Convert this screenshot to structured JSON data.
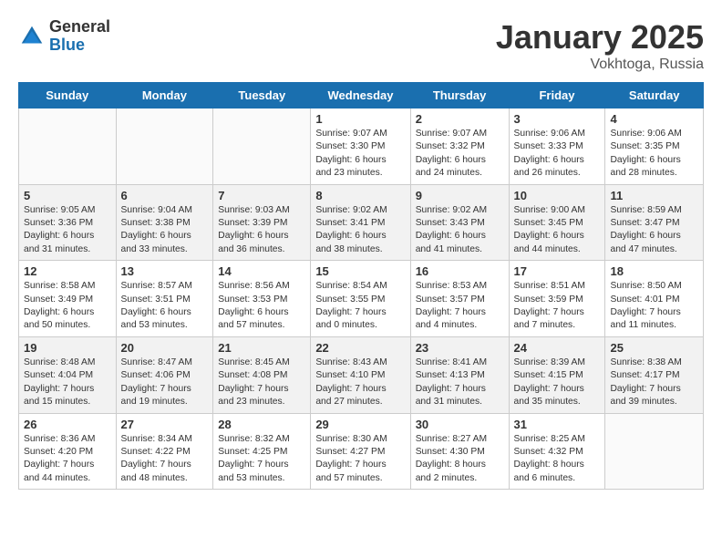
{
  "logo": {
    "general": "General",
    "blue": "Blue"
  },
  "title": "January 2025",
  "location": "Vokhtoga, Russia",
  "days_of_week": [
    "Sunday",
    "Monday",
    "Tuesday",
    "Wednesday",
    "Thursday",
    "Friday",
    "Saturday"
  ],
  "weeks": [
    [
      {
        "day": "",
        "info": ""
      },
      {
        "day": "",
        "info": ""
      },
      {
        "day": "",
        "info": ""
      },
      {
        "day": "1",
        "info": "Sunrise: 9:07 AM\nSunset: 3:30 PM\nDaylight: 6 hours\nand 23 minutes."
      },
      {
        "day": "2",
        "info": "Sunrise: 9:07 AM\nSunset: 3:32 PM\nDaylight: 6 hours\nand 24 minutes."
      },
      {
        "day": "3",
        "info": "Sunrise: 9:06 AM\nSunset: 3:33 PM\nDaylight: 6 hours\nand 26 minutes."
      },
      {
        "day": "4",
        "info": "Sunrise: 9:06 AM\nSunset: 3:35 PM\nDaylight: 6 hours\nand 28 minutes."
      }
    ],
    [
      {
        "day": "5",
        "info": "Sunrise: 9:05 AM\nSunset: 3:36 PM\nDaylight: 6 hours\nand 31 minutes."
      },
      {
        "day": "6",
        "info": "Sunrise: 9:04 AM\nSunset: 3:38 PM\nDaylight: 6 hours\nand 33 minutes."
      },
      {
        "day": "7",
        "info": "Sunrise: 9:03 AM\nSunset: 3:39 PM\nDaylight: 6 hours\nand 36 minutes."
      },
      {
        "day": "8",
        "info": "Sunrise: 9:02 AM\nSunset: 3:41 PM\nDaylight: 6 hours\nand 38 minutes."
      },
      {
        "day": "9",
        "info": "Sunrise: 9:02 AM\nSunset: 3:43 PM\nDaylight: 6 hours\nand 41 minutes."
      },
      {
        "day": "10",
        "info": "Sunrise: 9:00 AM\nSunset: 3:45 PM\nDaylight: 6 hours\nand 44 minutes."
      },
      {
        "day": "11",
        "info": "Sunrise: 8:59 AM\nSunset: 3:47 PM\nDaylight: 6 hours\nand 47 minutes."
      }
    ],
    [
      {
        "day": "12",
        "info": "Sunrise: 8:58 AM\nSunset: 3:49 PM\nDaylight: 6 hours\nand 50 minutes."
      },
      {
        "day": "13",
        "info": "Sunrise: 8:57 AM\nSunset: 3:51 PM\nDaylight: 6 hours\nand 53 minutes."
      },
      {
        "day": "14",
        "info": "Sunrise: 8:56 AM\nSunset: 3:53 PM\nDaylight: 6 hours\nand 57 minutes."
      },
      {
        "day": "15",
        "info": "Sunrise: 8:54 AM\nSunset: 3:55 PM\nDaylight: 7 hours\nand 0 minutes."
      },
      {
        "day": "16",
        "info": "Sunrise: 8:53 AM\nSunset: 3:57 PM\nDaylight: 7 hours\nand 4 minutes."
      },
      {
        "day": "17",
        "info": "Sunrise: 8:51 AM\nSunset: 3:59 PM\nDaylight: 7 hours\nand 7 minutes."
      },
      {
        "day": "18",
        "info": "Sunrise: 8:50 AM\nSunset: 4:01 PM\nDaylight: 7 hours\nand 11 minutes."
      }
    ],
    [
      {
        "day": "19",
        "info": "Sunrise: 8:48 AM\nSunset: 4:04 PM\nDaylight: 7 hours\nand 15 minutes."
      },
      {
        "day": "20",
        "info": "Sunrise: 8:47 AM\nSunset: 4:06 PM\nDaylight: 7 hours\nand 19 minutes."
      },
      {
        "day": "21",
        "info": "Sunrise: 8:45 AM\nSunset: 4:08 PM\nDaylight: 7 hours\nand 23 minutes."
      },
      {
        "day": "22",
        "info": "Sunrise: 8:43 AM\nSunset: 4:10 PM\nDaylight: 7 hours\nand 27 minutes."
      },
      {
        "day": "23",
        "info": "Sunrise: 8:41 AM\nSunset: 4:13 PM\nDaylight: 7 hours\nand 31 minutes."
      },
      {
        "day": "24",
        "info": "Sunrise: 8:39 AM\nSunset: 4:15 PM\nDaylight: 7 hours\nand 35 minutes."
      },
      {
        "day": "25",
        "info": "Sunrise: 8:38 AM\nSunset: 4:17 PM\nDaylight: 7 hours\nand 39 minutes."
      }
    ],
    [
      {
        "day": "26",
        "info": "Sunrise: 8:36 AM\nSunset: 4:20 PM\nDaylight: 7 hours\nand 44 minutes."
      },
      {
        "day": "27",
        "info": "Sunrise: 8:34 AM\nSunset: 4:22 PM\nDaylight: 7 hours\nand 48 minutes."
      },
      {
        "day": "28",
        "info": "Sunrise: 8:32 AM\nSunset: 4:25 PM\nDaylight: 7 hours\nand 53 minutes."
      },
      {
        "day": "29",
        "info": "Sunrise: 8:30 AM\nSunset: 4:27 PM\nDaylight: 7 hours\nand 57 minutes."
      },
      {
        "day": "30",
        "info": "Sunrise: 8:27 AM\nSunset: 4:30 PM\nDaylight: 8 hours\nand 2 minutes."
      },
      {
        "day": "31",
        "info": "Sunrise: 8:25 AM\nSunset: 4:32 PM\nDaylight: 8 hours\nand 6 minutes."
      },
      {
        "day": "",
        "info": ""
      }
    ]
  ]
}
